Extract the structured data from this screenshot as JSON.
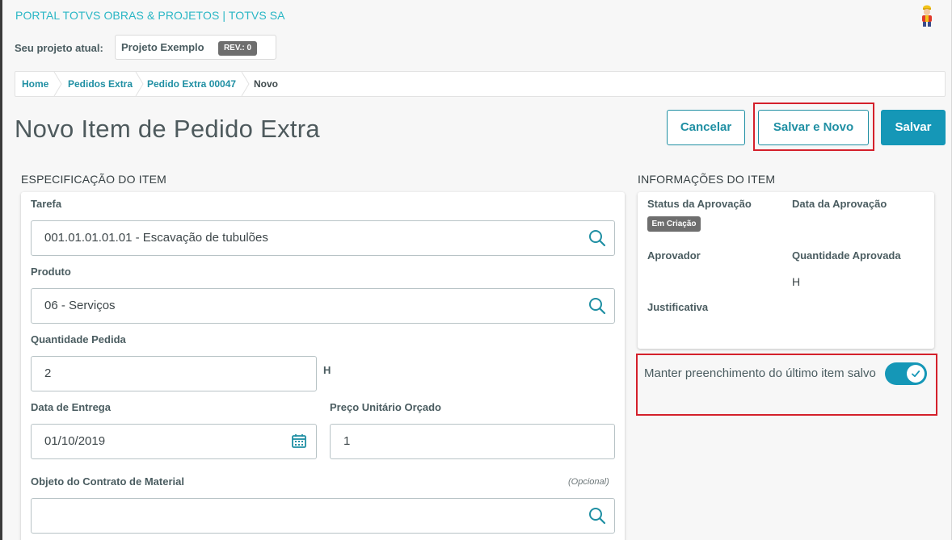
{
  "header": {
    "portal_title": "PORTAL TOTVS OBRAS & PROJETOS | TOTVS SA",
    "project_label": "Seu projeto atual:",
    "project_name": "Projeto Exemplo",
    "revision": "REV.: 0"
  },
  "breadcrumb": {
    "items": [
      "Home",
      "Pedidos Extra",
      "Pedido Extra 00047"
    ],
    "current": "Novo"
  },
  "page": {
    "title": "Novo Item de Pedido Extra"
  },
  "actions": {
    "cancel": "Cancelar",
    "save_new": "Salvar e Novo",
    "save": "Salvar"
  },
  "spec": {
    "section_title": "ESPECIFICAÇÃO DO ITEM",
    "tarefa_label": "Tarefa",
    "tarefa_value": "001.01.01.01.01 - Escavação de tubulões",
    "produto_label": "Produto",
    "produto_value": "06 - Serviços",
    "quantidade_label": "Quantidade Pedida",
    "quantidade_value": "2",
    "quantidade_unit": "H",
    "data_label": "Data de Entrega",
    "data_value": "01/10/2019",
    "preco_label": "Preço Unitário Orçado",
    "preco_value": "1",
    "objeto_label": "Objeto do Contrato de Material",
    "objeto_optional": "(Opcional)",
    "objeto_value": ""
  },
  "info": {
    "section_title": "INFORMAÇÕES DO ITEM",
    "status_label": "Status da Aprovação",
    "status_value": "Em Criação",
    "data_aprov_label": "Data da Aprovação",
    "aprovador_label": "Aprovador",
    "qtd_aprov_label": "Quantidade Aprovada",
    "qtd_aprov_unit": "H",
    "justificativa_label": "Justificativa"
  },
  "keep_fill": {
    "label": "Manter preenchimento do último item salvo",
    "enabled": true
  },
  "colors": {
    "accent": "#1597b7",
    "link": "#1f8fa3",
    "highlight": "#d4202b",
    "badge": "#6e6e6e"
  }
}
